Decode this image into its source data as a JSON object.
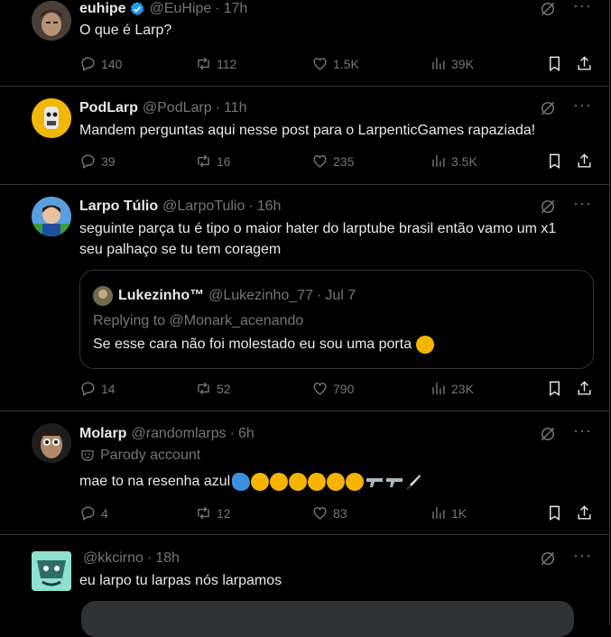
{
  "colors": {
    "background": "#000000",
    "text": "#e7e9ea",
    "muted": "#71767b",
    "divider": "#2f3336",
    "verified": "#1d9bf0"
  },
  "tweets": [
    {
      "name": "euhipe",
      "handle": "@EuHipe",
      "sep": "·",
      "time": "17h",
      "verified": true,
      "text": "O que é Larp?",
      "replies": "140",
      "reposts": "112",
      "likes": "1.5K",
      "views": "39K"
    },
    {
      "name": "PodLarp",
      "handle": "@PodLarp",
      "sep": "·",
      "time": "11h",
      "text": "Mandem perguntas aqui nesse post para o LarpenticGames rapaziada!",
      "replies": "39",
      "reposts": "16",
      "likes": "235",
      "views": "3.5K"
    },
    {
      "name": "Larpo Túlio",
      "handle": "@LarpoTulio",
      "sep": "·",
      "time": "16h",
      "text_line1": "seguinte parça tu é tipo o maior hater do larptube brasil então vamo um x1",
      "text_line2": "seu palhaço se tu tem coragem",
      "quote": {
        "name": "Lukezinho™",
        "handle": "@Lukezinho_77",
        "sep": "·",
        "time": "Jul 7",
        "replying": "Replying to @Monark_acenando",
        "text": "Se esse cara não foi molestado eu sou uma porta"
      },
      "replies": "14",
      "reposts": "52",
      "likes": "790",
      "views": "23K"
    },
    {
      "name": "Molarp",
      "handle": "@randomlarps",
      "sep": "·",
      "time": "6h",
      "parody": "Parody account",
      "text": "mae to na resenha azul",
      "replies": "4",
      "reposts": "12",
      "likes": "83",
      "views": "1K"
    },
    {
      "name": "",
      "handle": "@kkcirno",
      "sep": "·",
      "time": "18h",
      "text": "eu larpo tu larpas nós larpamos"
    }
  ]
}
